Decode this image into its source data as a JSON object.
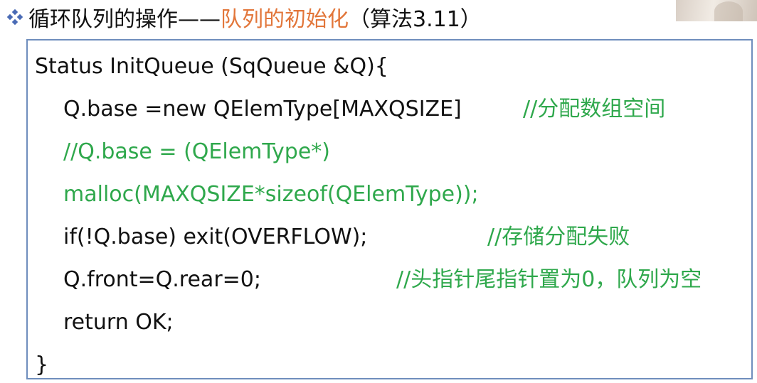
{
  "heading": {
    "bullet_icon": "diamond-bullet-icon",
    "prefix": "循环队列的操作——",
    "highlight": "队列的初始化",
    "suffix": "（算法3.11）"
  },
  "code": {
    "line1": "Status InitQueue (SqQueue &Q){",
    "line2_code": "Q.base =new QElemType[MAXQSIZE]",
    "line2_comment": "//分配数组空间",
    "line3_comment": "//Q.base = (QElemType*)",
    "line4_comment": "malloc(MAXQSIZE*sizeof(QElemType));",
    "line5_code": "if(!Q.base) exit(OVERFLOW);",
    "line5_comment": "//存储分配失败",
    "line6_code": "Q.front=Q.rear=0;",
    "line6_comment": "//头指针尾指针置为0，队列为空",
    "line7_code": "return OK;",
    "line8": "}"
  },
  "colors": {
    "text": "#111111",
    "highlight": "#e2763a",
    "comment": "#2fa84c",
    "box_border": "#6f8ebd",
    "bullet": "#4a6bb5"
  }
}
